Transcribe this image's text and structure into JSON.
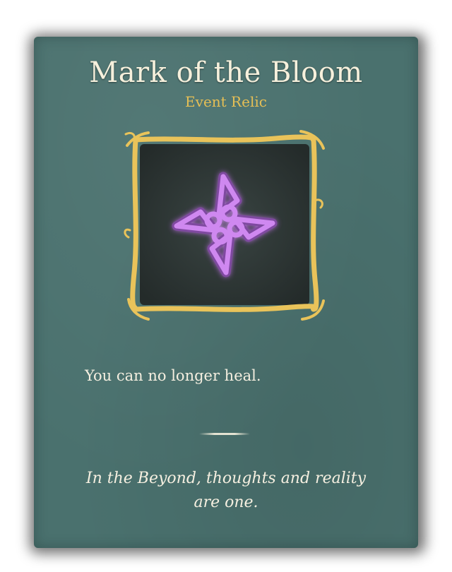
{
  "relic": {
    "name": "Mark of the Bloom",
    "rarity": "Event Relic",
    "description": "You can no longer heal.",
    "flavor_line1": "In the Beyond, thoughts and reality",
    "flavor_line2": "are one.",
    "icon": "purple-knot-sigil-icon"
  },
  "colors": {
    "card_bg": "#4a716e",
    "title": "#f6f0dc",
    "rarity": "#e6bf55",
    "frame_gold": "#e9c35a",
    "sigil_purple": "#c77ee6",
    "art_bg": "#2c3432"
  }
}
